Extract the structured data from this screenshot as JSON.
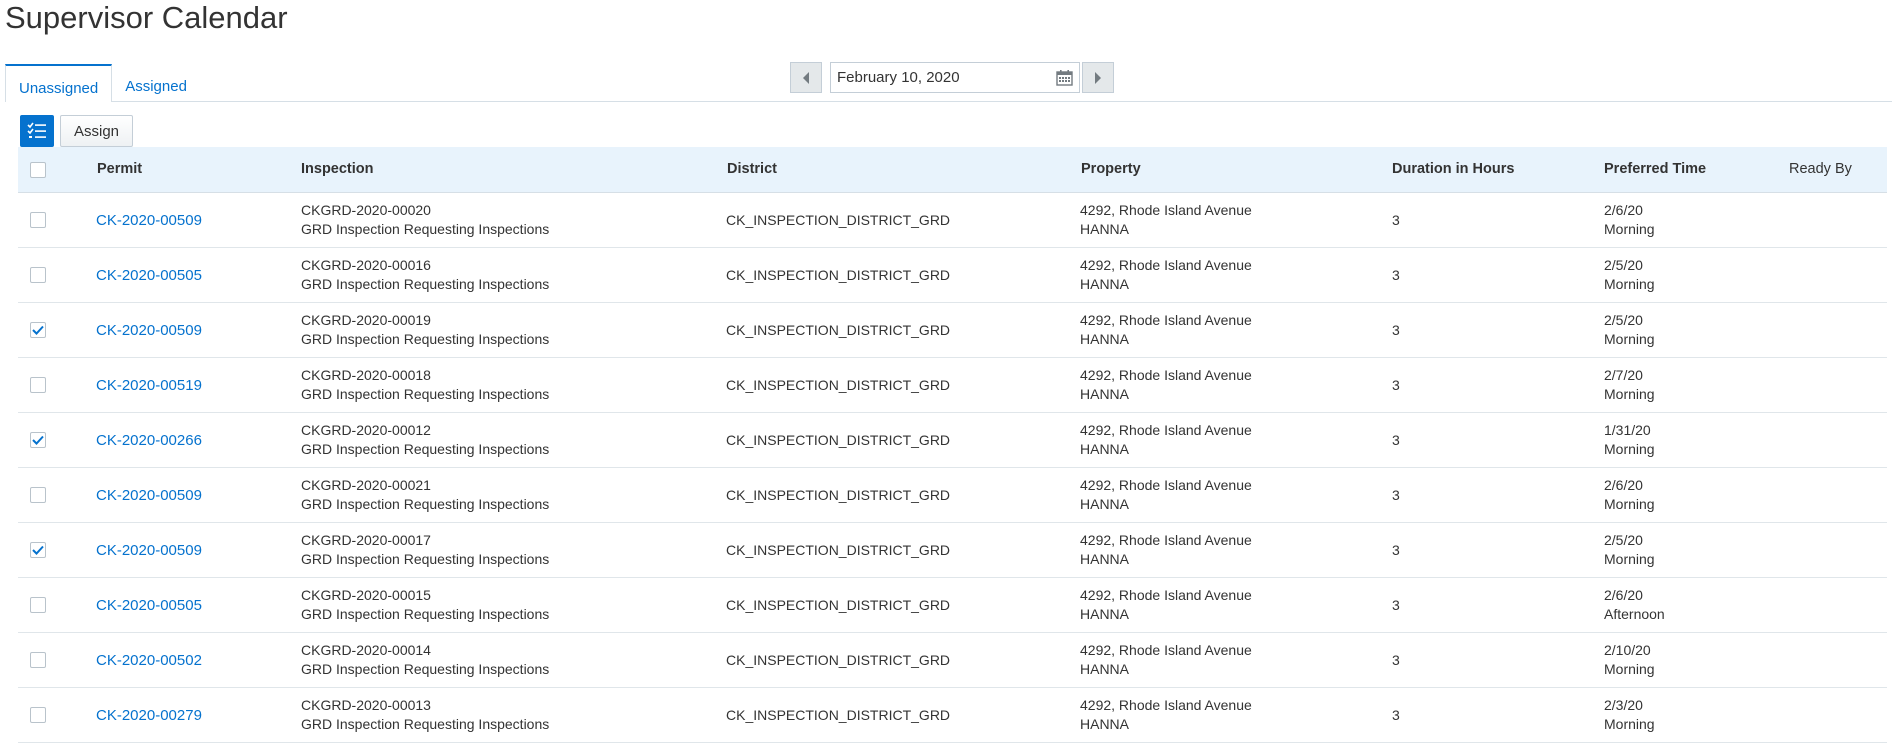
{
  "page": {
    "title": "Supervisor Calendar"
  },
  "tabs": [
    {
      "label": "Unassigned",
      "active": true
    },
    {
      "label": "Assigned",
      "active": false
    }
  ],
  "date_nav": {
    "value": "February 10, 2020"
  },
  "toolbar": {
    "assign_label": "Assign"
  },
  "columns": {
    "permit": "Permit",
    "inspection": "Inspection",
    "district": "District",
    "property": "Property",
    "duration": "Duration in Hours",
    "preferred": "Preferred Time",
    "ready": "Ready By"
  },
  "rows": [
    {
      "checked": false,
      "permit": "CK-2020-00509",
      "insp_id": "CKGRD-2020-00020",
      "insp_desc": "GRD Inspection Requesting Inspections",
      "district": "CK_INSPECTION_DISTRICT_GRD",
      "address": "4292, Rhode Island Avenue",
      "city": "HANNA",
      "duration": "3",
      "pref_date": "2/6/20",
      "pref_slot": "Morning"
    },
    {
      "checked": false,
      "permit": "CK-2020-00505",
      "insp_id": "CKGRD-2020-00016",
      "insp_desc": "GRD Inspection Requesting Inspections",
      "district": "CK_INSPECTION_DISTRICT_GRD",
      "address": "4292, Rhode Island Avenue",
      "city": "HANNA",
      "duration": "3",
      "pref_date": "2/5/20",
      "pref_slot": "Morning"
    },
    {
      "checked": true,
      "permit": "CK-2020-00509",
      "insp_id": "CKGRD-2020-00019",
      "insp_desc": "GRD Inspection Requesting Inspections",
      "district": "CK_INSPECTION_DISTRICT_GRD",
      "address": "4292, Rhode Island Avenue",
      "city": "HANNA",
      "duration": "3",
      "pref_date": "2/5/20",
      "pref_slot": "Morning"
    },
    {
      "checked": false,
      "permit": "CK-2020-00519",
      "insp_id": "CKGRD-2020-00018",
      "insp_desc": "GRD Inspection Requesting Inspections",
      "district": "CK_INSPECTION_DISTRICT_GRD",
      "address": "4292, Rhode Island Avenue",
      "city": "HANNA",
      "duration": "3",
      "pref_date": "2/7/20",
      "pref_slot": "Morning"
    },
    {
      "checked": true,
      "permit": "CK-2020-00266",
      "insp_id": "CKGRD-2020-00012",
      "insp_desc": "GRD Inspection Requesting Inspections",
      "district": "CK_INSPECTION_DISTRICT_GRD",
      "address": "4292, Rhode Island Avenue",
      "city": "HANNA",
      "duration": "3",
      "pref_date": "1/31/20",
      "pref_slot": "Morning"
    },
    {
      "checked": false,
      "permit": "CK-2020-00509",
      "insp_id": "CKGRD-2020-00021",
      "insp_desc": "GRD Inspection Requesting Inspections",
      "district": "CK_INSPECTION_DISTRICT_GRD",
      "address": "4292, Rhode Island Avenue",
      "city": "HANNA",
      "duration": "3",
      "pref_date": "2/6/20",
      "pref_slot": "Morning"
    },
    {
      "checked": true,
      "permit": "CK-2020-00509",
      "insp_id": "CKGRD-2020-00017",
      "insp_desc": "GRD Inspection Requesting Inspections",
      "district": "CK_INSPECTION_DISTRICT_GRD",
      "address": "4292, Rhode Island Avenue",
      "city": "HANNA",
      "duration": "3",
      "pref_date": "2/5/20",
      "pref_slot": "Morning"
    },
    {
      "checked": false,
      "permit": "CK-2020-00505",
      "insp_id": "CKGRD-2020-00015",
      "insp_desc": "GRD Inspection Requesting Inspections",
      "district": "CK_INSPECTION_DISTRICT_GRD",
      "address": "4292, Rhode Island Avenue",
      "city": "HANNA",
      "duration": "3",
      "pref_date": "2/6/20",
      "pref_slot": "Afternoon"
    },
    {
      "checked": false,
      "permit": "CK-2020-00502",
      "insp_id": "CKGRD-2020-00014",
      "insp_desc": "GRD Inspection Requesting Inspections",
      "district": "CK_INSPECTION_DISTRICT_GRD",
      "address": "4292, Rhode Island Avenue",
      "city": "HANNA",
      "duration": "3",
      "pref_date": "2/10/20",
      "pref_slot": "Morning"
    },
    {
      "checked": false,
      "permit": "CK-2020-00279",
      "insp_id": "CKGRD-2020-00013",
      "insp_desc": "GRD Inspection Requesting Inspections",
      "district": "CK_INSPECTION_DISTRICT_GRD",
      "address": "4292, Rhode Island Avenue",
      "city": "HANNA",
      "duration": "3",
      "pref_date": "2/3/20",
      "pref_slot": "Morning"
    }
  ]
}
